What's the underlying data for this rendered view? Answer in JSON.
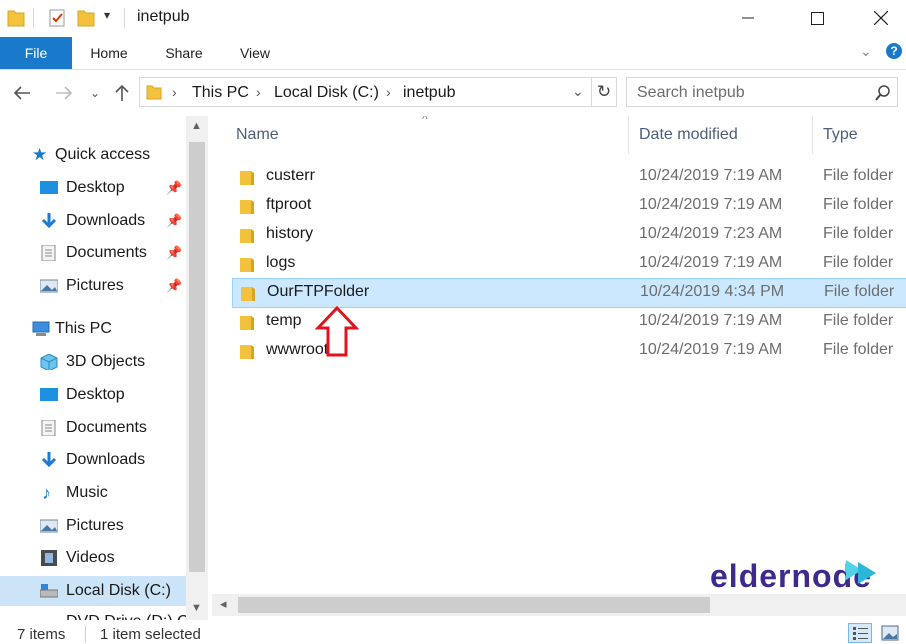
{
  "window": {
    "title": "inetpub",
    "minimize_icon": "minimize-icon",
    "maximize_icon": "maximize-icon",
    "close_icon": "close-icon"
  },
  "ribbon": {
    "tabs": [
      "File",
      "Home",
      "Share",
      "View"
    ]
  },
  "address": {
    "crumbs": [
      "This PC",
      "Local Disk (C:)",
      "inetpub"
    ],
    "search_placeholder": "Search inetpub"
  },
  "nav": {
    "quick_access": "Quick access",
    "quick_items": [
      "Desktop",
      "Downloads",
      "Documents",
      "Pictures"
    ],
    "this_pc": "This PC",
    "pc_items": [
      "3D Objects",
      "Desktop",
      "Documents",
      "Downloads",
      "Music",
      "Pictures",
      "Videos",
      "Local Disk (C:)"
    ],
    "partial_item": "DVD Drive (D:) C"
  },
  "columns": {
    "name": "Name",
    "date": "Date modified",
    "type": "Type"
  },
  "files": [
    {
      "name": "custerr",
      "date": "10/24/2019 7:19 AM",
      "type": "File folder"
    },
    {
      "name": "ftproot",
      "date": "10/24/2019 7:19 AM",
      "type": "File folder"
    },
    {
      "name": "history",
      "date": "10/24/2019 7:23 AM",
      "type": "File folder"
    },
    {
      "name": "logs",
      "date": "10/24/2019 7:19 AM",
      "type": "File folder"
    },
    {
      "name": "OurFTPFolder",
      "date": "10/24/2019 4:34 PM",
      "type": "File folder"
    },
    {
      "name": "temp",
      "date": "10/24/2019 7:19 AM",
      "type": "File folder"
    },
    {
      "name": "wwwroot",
      "date": "10/24/2019 7:19 AM",
      "type": "File folder"
    }
  ],
  "status": {
    "count": "7 items",
    "selected": "1 item selected"
  },
  "watermark": "eldernode",
  "colors": {
    "accent": "#1979ca",
    "selection": "#cce8ff",
    "folder": "#f3c23d",
    "arrow": "#e0141e"
  }
}
